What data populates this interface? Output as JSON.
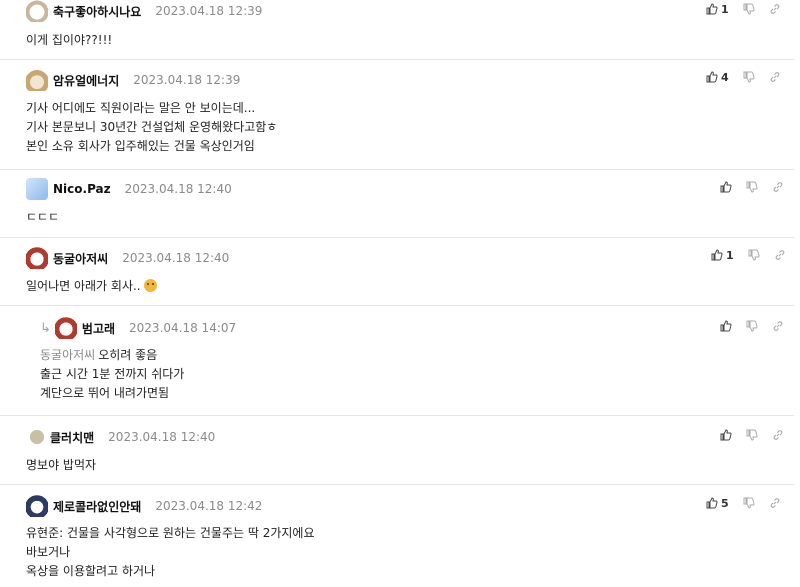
{
  "comments": [
    {
      "nick": "축구좋아하시나요",
      "time": "2023.04.18 12:39",
      "likes": "1",
      "lines": [
        "이게 집이야??!!!"
      ]
    },
    {
      "nick": "암유얼에너지",
      "time": "2023.04.18 12:39",
      "likes": "4",
      "lines": [
        "기사 어디에도 직원이라는 말은 안 보이는데...",
        "기사 본문보니 30년간 건설업체 운영해왔다고함ㅎ",
        "본인 소유 회사가 입주해있는 건물 옥상인거임"
      ]
    },
    {
      "nick": "Nico.Paz",
      "time": "2023.04.18 12:40",
      "likes": "",
      "lines": [
        "ㄷㄷㄷ"
      ]
    },
    {
      "nick": "동굴아저씨",
      "time": "2023.04.18 12:40",
      "likes": "1",
      "lines": [
        "일어나면 아래가 회사.."
      ]
    },
    {
      "nick": "범고래",
      "time": "2023.04.18 14:07",
      "likes": "",
      "mention": "동굴아저씨",
      "lines": [
        "오히려 좋음",
        "출근 시간 1분 전까지 쉬다가",
        "계단으로 뛰어 내려가면됨"
      ]
    },
    {
      "nick": "클러치맨",
      "time": "2023.04.18 12:40",
      "likes": "",
      "lines": [
        "명보야 밥먹자"
      ]
    },
    {
      "nick": "제로콜라없인안돼",
      "time": "2023.04.18 12:42",
      "likes": "5",
      "lines": [
        "유현준: 건물을 사각형으로 원하는 건물주는 딱 2가지에요",
        "바보거나",
        "옥상을 이용할려고 하거나"
      ]
    }
  ]
}
